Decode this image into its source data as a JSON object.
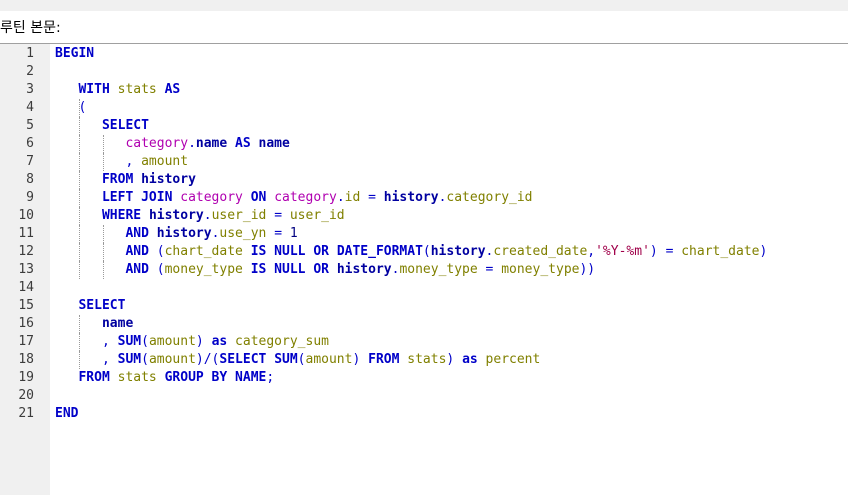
{
  "header": {
    "title": "루틴 본문:"
  },
  "editor": {
    "lines": [
      [
        {
          "t": "BEGIN",
          "c": "kw"
        }
      ],
      [],
      [
        {
          "t": "   "
        },
        {
          "t": "WITH",
          "c": "kw"
        },
        {
          "t": " "
        },
        {
          "t": "stats",
          "c": "id"
        },
        {
          "t": " "
        },
        {
          "t": "AS",
          "c": "kw"
        }
      ],
      [
        {
          "t": "   "
        },
        {
          "t": "(",
          "c": "op"
        }
      ],
      [
        {
          "t": "      "
        },
        {
          "t": "SELECT",
          "c": "kw"
        }
      ],
      [
        {
          "t": "         "
        },
        {
          "t": "category",
          "c": "pk"
        },
        {
          "t": ".",
          "c": "op"
        },
        {
          "t": "name",
          "c": "tb"
        },
        {
          "t": " "
        },
        {
          "t": "AS",
          "c": "kw"
        },
        {
          "t": " "
        },
        {
          "t": "name",
          "c": "tb"
        }
      ],
      [
        {
          "t": "         "
        },
        {
          "t": ",",
          "c": "op"
        },
        {
          "t": " "
        },
        {
          "t": "amount",
          "c": "id"
        }
      ],
      [
        {
          "t": "      "
        },
        {
          "t": "FROM",
          "c": "kw"
        },
        {
          "t": " "
        },
        {
          "t": "history",
          "c": "tb"
        }
      ],
      [
        {
          "t": "      "
        },
        {
          "t": "LEFT JOIN",
          "c": "kw"
        },
        {
          "t": " "
        },
        {
          "t": "category",
          "c": "pk"
        },
        {
          "t": " "
        },
        {
          "t": "ON",
          "c": "kw"
        },
        {
          "t": " "
        },
        {
          "t": "category",
          "c": "pk"
        },
        {
          "t": ".",
          "c": "op"
        },
        {
          "t": "id",
          "c": "id"
        },
        {
          "t": " "
        },
        {
          "t": "=",
          "c": "op"
        },
        {
          "t": " "
        },
        {
          "t": "history",
          "c": "tb"
        },
        {
          "t": ".",
          "c": "op"
        },
        {
          "t": "category_id",
          "c": "id"
        }
      ],
      [
        {
          "t": "      "
        },
        {
          "t": "WHERE",
          "c": "kw"
        },
        {
          "t": " "
        },
        {
          "t": "history",
          "c": "tb"
        },
        {
          "t": ".",
          "c": "op"
        },
        {
          "t": "user_id",
          "c": "id"
        },
        {
          "t": " "
        },
        {
          "t": "=",
          "c": "op"
        },
        {
          "t": " "
        },
        {
          "t": "user_id",
          "c": "id"
        }
      ],
      [
        {
          "t": "         "
        },
        {
          "t": "AND",
          "c": "kw"
        },
        {
          "t": " "
        },
        {
          "t": "history",
          "c": "tb"
        },
        {
          "t": ".",
          "c": "op"
        },
        {
          "t": "use_yn",
          "c": "id"
        },
        {
          "t": " "
        },
        {
          "t": "=",
          "c": "op"
        },
        {
          "t": " "
        },
        {
          "t": "1",
          "c": "num"
        }
      ],
      [
        {
          "t": "         "
        },
        {
          "t": "AND",
          "c": "kw"
        },
        {
          "t": " "
        },
        {
          "t": "(",
          "c": "op"
        },
        {
          "t": "chart_date",
          "c": "id"
        },
        {
          "t": " "
        },
        {
          "t": "IS NULL",
          "c": "kw"
        },
        {
          "t": " "
        },
        {
          "t": "OR",
          "c": "kw"
        },
        {
          "t": " "
        },
        {
          "t": "DATE_FORMAT",
          "c": "kw"
        },
        {
          "t": "(",
          "c": "op"
        },
        {
          "t": "history",
          "c": "tb"
        },
        {
          "t": ".",
          "c": "op"
        },
        {
          "t": "created_date",
          "c": "id"
        },
        {
          "t": ",",
          "c": "op"
        },
        {
          "t": "'%Y-%m'",
          "c": "str"
        },
        {
          "t": ")",
          "c": "op"
        },
        {
          "t": " "
        },
        {
          "t": "=",
          "c": "op"
        },
        {
          "t": " "
        },
        {
          "t": "chart_date",
          "c": "id"
        },
        {
          "t": ")",
          "c": "op"
        }
      ],
      [
        {
          "t": "         "
        },
        {
          "t": "AND",
          "c": "kw"
        },
        {
          "t": " "
        },
        {
          "t": "(",
          "c": "op"
        },
        {
          "t": "money_type",
          "c": "id"
        },
        {
          "t": " "
        },
        {
          "t": "IS NULL",
          "c": "kw"
        },
        {
          "t": " "
        },
        {
          "t": "OR",
          "c": "kw"
        },
        {
          "t": " "
        },
        {
          "t": "history",
          "c": "tb"
        },
        {
          "t": ".",
          "c": "op"
        },
        {
          "t": "money_type",
          "c": "id"
        },
        {
          "t": " "
        },
        {
          "t": "=",
          "c": "op"
        },
        {
          "t": " "
        },
        {
          "t": "money_type",
          "c": "id"
        },
        {
          "t": "))",
          "c": "op"
        }
      ],
      [],
      [
        {
          "t": "   "
        },
        {
          "t": "SELECT",
          "c": "kw"
        }
      ],
      [
        {
          "t": "      "
        },
        {
          "t": "name",
          "c": "tb"
        }
      ],
      [
        {
          "t": "      "
        },
        {
          "t": ",",
          "c": "op"
        },
        {
          "t": " "
        },
        {
          "t": "SUM",
          "c": "kw"
        },
        {
          "t": "(",
          "c": "op"
        },
        {
          "t": "amount",
          "c": "id"
        },
        {
          "t": ")",
          "c": "op"
        },
        {
          "t": " "
        },
        {
          "t": "as",
          "c": "kw"
        },
        {
          "t": " "
        },
        {
          "t": "category_sum",
          "c": "id"
        }
      ],
      [
        {
          "t": "      "
        },
        {
          "t": ",",
          "c": "op"
        },
        {
          "t": " "
        },
        {
          "t": "SUM",
          "c": "kw"
        },
        {
          "t": "(",
          "c": "op"
        },
        {
          "t": "amount",
          "c": "id"
        },
        {
          "t": ")/(",
          "c": "op"
        },
        {
          "t": "SELECT",
          "c": "kw"
        },
        {
          "t": " "
        },
        {
          "t": "SUM",
          "c": "kw"
        },
        {
          "t": "(",
          "c": "op"
        },
        {
          "t": "amount",
          "c": "id"
        },
        {
          "t": ")",
          "c": "op"
        },
        {
          "t": " "
        },
        {
          "t": "FROM",
          "c": "kw"
        },
        {
          "t": " "
        },
        {
          "t": "stats",
          "c": "id"
        },
        {
          "t": ")",
          "c": "op"
        },
        {
          "t": " "
        },
        {
          "t": "as",
          "c": "kw"
        },
        {
          "t": " "
        },
        {
          "t": "percent",
          "c": "id"
        }
      ],
      [
        {
          "t": "   "
        },
        {
          "t": "FROM",
          "c": "kw"
        },
        {
          "t": " "
        },
        {
          "t": "stats",
          "c": "id"
        },
        {
          "t": " "
        },
        {
          "t": "GROUP BY",
          "c": "kw"
        },
        {
          "t": " "
        },
        {
          "t": "NAME",
          "c": "kw"
        },
        {
          "t": ";",
          "c": "op"
        }
      ],
      [],
      [
        {
          "t": "END",
          "c": "kw"
        }
      ]
    ]
  }
}
